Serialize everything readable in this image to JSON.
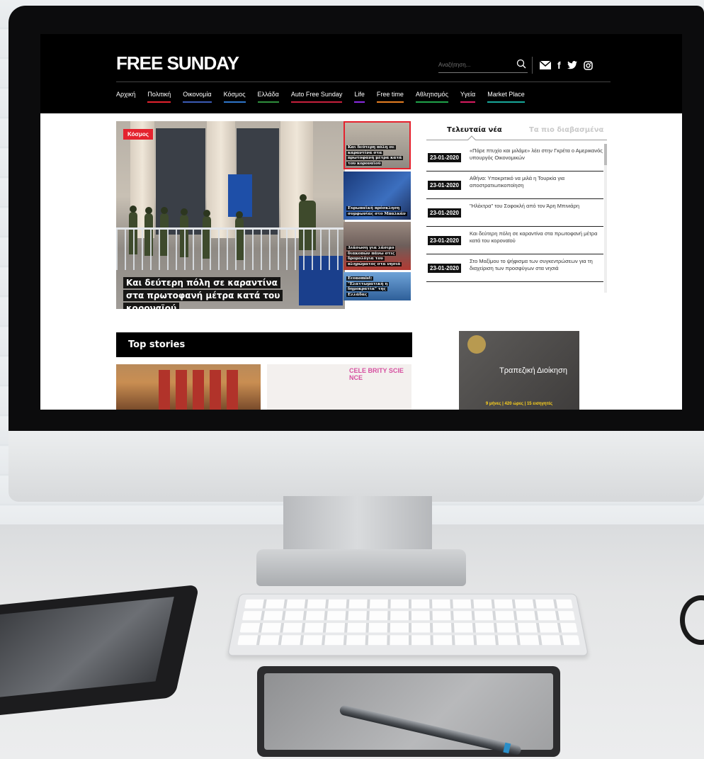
{
  "site": {
    "logo": "FREE SUNDAY",
    "search_placeholder": "Αναζήτηση...",
    "social_icons": [
      "mail-icon",
      "facebook-icon",
      "twitter-icon",
      "instagram-icon"
    ]
  },
  "nav": {
    "items": [
      {
        "label": "Αρχική",
        "color": "#000000"
      },
      {
        "label": "Πολιτική",
        "color": "#e4222e"
      },
      {
        "label": "Οικονομία",
        "color": "#3b5bb5"
      },
      {
        "label": "Κόσμος",
        "color": "#2f76c9"
      },
      {
        "label": "Ελλάδα",
        "color": "#2f8f3d"
      },
      {
        "label": "Auto Free Sunday",
        "color": "#c7203c"
      },
      {
        "label": "Life",
        "color": "#8a2be2"
      },
      {
        "label": "Free time",
        "color": "#e67e22"
      },
      {
        "label": "Αθλητισμός",
        "color": "#1fa34a"
      },
      {
        "label": "Υγεία",
        "color": "#d81b60"
      },
      {
        "label": "Market Place",
        "color": "#18a89a"
      }
    ]
  },
  "hero": {
    "category": "Κόσμος",
    "title": "Και δεύτερη πόλη σε καραντίνα στα πρωτοφανή μέτρα κατά του κοροναϊού"
  },
  "thumbnails": [
    {
      "caption": "Και δεύτερη πόλη σε καραντίνα στα πρωτοφανή μέτρα κατά του κοροναϊού",
      "active": true
    },
    {
      "caption": "Ευρωπαϊκή πρόσκληση συμφωνίας στο Μπαλκάν",
      "active": false
    },
    {
      "caption": "Διάσωση για λάσιμο διακοπών πάνω στις δρομολόγια του πληρώματος στα νησιά",
      "active": false
    },
    {
      "caption": "Economist: \"Ελαττωματική η δημοκρατία\" της Ελλάδας",
      "active": false
    }
  ],
  "latest": {
    "tab_active": "Τελευταία νέα",
    "tab_inactive": "Τα πιο διαβασμένα",
    "items": [
      {
        "date": "23-01-2020",
        "text": "«Πάρε πτυχίο και μιλάμε» λέει στην Γκρέτα ο Αμερικανός υπουργός Οικονομικών"
      },
      {
        "date": "23-01-2020",
        "text": "Αθήνα: Υποκριτικό να μιλά η Τουρκία για αποστρατιωτικοποίηση"
      },
      {
        "date": "23-01-2020",
        "text": "\"Ηλέκτρα\" του Σοφοκλή από τον Άρη Μπινιάρη"
      },
      {
        "date": "23-01-2020",
        "text": "Και δεύτερη πόλη σε καραντίνα στα πρωτοφανή μέτρα κατά του κοροναϊού"
      },
      {
        "date": "23-01-2020",
        "text": "Στο Μαξίμου το ψήφισμα των συγκεντρώσεων για τη διαχείριση των προσφύγων στα νησιά"
      }
    ]
  },
  "top_stories": {
    "heading": "Top stories",
    "story2_sign": "CELE BRITY SCIE NCE"
  },
  "ad": {
    "title": "Τραπεζική Διοίκηση",
    "subtitle": "9 μήνες | 420 ώρες | 15 εισηγητές"
  }
}
